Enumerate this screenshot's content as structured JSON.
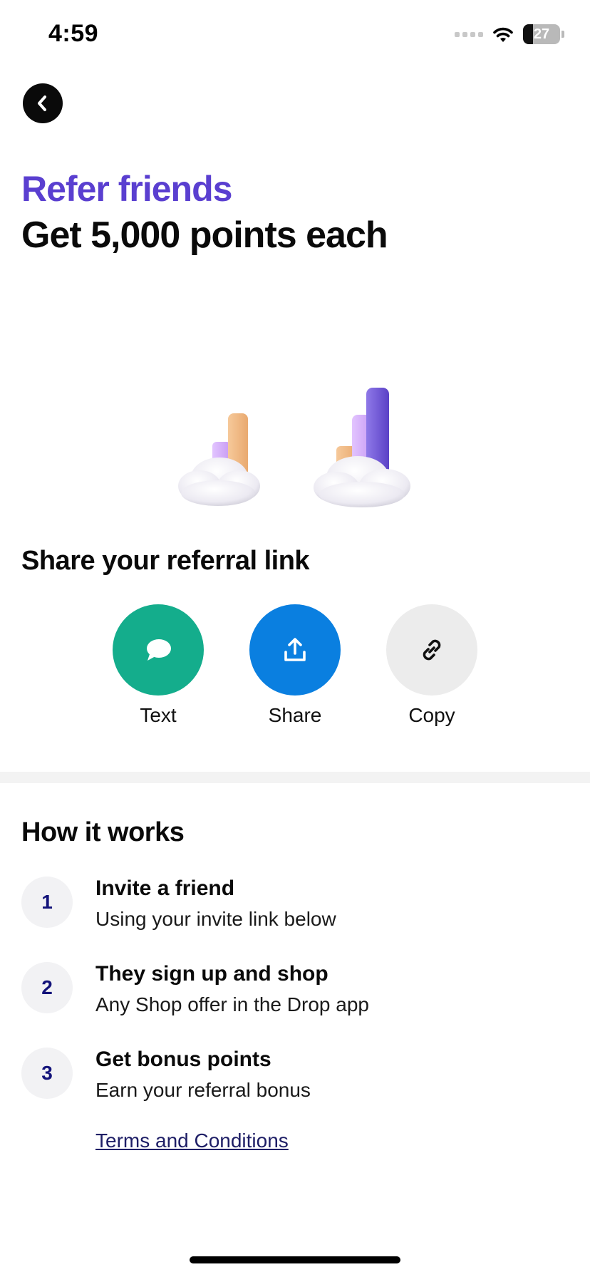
{
  "status_bar": {
    "time": "4:59",
    "battery_level": "27",
    "battery_fraction": 0.27
  },
  "header": {
    "back_icon": "chevron-left-icon"
  },
  "hero": {
    "title_line1": "Refer friends",
    "title_line2": "Get 5,000 points each"
  },
  "share": {
    "heading": "Share your referral link",
    "actions": [
      {
        "label": "Text",
        "icon": "chat-bubble-icon",
        "color": "#14ad8c"
      },
      {
        "label": "Share",
        "icon": "upload-icon",
        "color": "#0a7fe0"
      },
      {
        "label": "Copy",
        "icon": "link-icon",
        "color": "#ececec"
      }
    ]
  },
  "how_it_works": {
    "heading": "How it works",
    "steps": [
      {
        "number": "1",
        "title": "Invite a friend",
        "subtitle": "Using your invite link below"
      },
      {
        "number": "2",
        "title": "They sign up and shop",
        "subtitle": "Any Shop offer in the Drop app"
      },
      {
        "number": "3",
        "title": "Get bonus points",
        "subtitle": "Earn your referral bonus"
      }
    ],
    "terms_link": "Terms and Conditions"
  },
  "colors": {
    "accent_purple": "#5a3fd0",
    "step_number": "#13137a",
    "link": "#1e1e66"
  }
}
